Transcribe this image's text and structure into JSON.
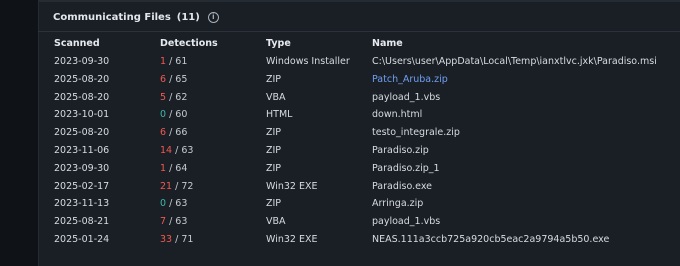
{
  "section": {
    "title": "Communicating Files",
    "count": "(11)",
    "info_icon": "info-icon"
  },
  "columns": {
    "scanned": "Scanned",
    "detections": "Detections",
    "type": "Type",
    "name": "Name"
  },
  "colors": {
    "detection_positive": "#f0584f",
    "detection_zero": "#3fb7a8",
    "link": "#6f9ff0"
  },
  "rows": [
    {
      "scanned": "2023-09-30",
      "det_hits": "1",
      "det_total": " / 61",
      "type": "Windows Installer",
      "name": "C:\\Users\\user\\AppData\\Local\\Temp\\ianxtlvc.jxk\\Paradiso.msi",
      "link": false
    },
    {
      "scanned": "2025-08-20",
      "det_hits": "6",
      "det_total": " / 65",
      "type": "ZIP",
      "name": "Patch_Aruba.zip",
      "link": true
    },
    {
      "scanned": "2025-08-20",
      "det_hits": "5",
      "det_total": " / 62",
      "type": "VBA",
      "name": "payload_1.vbs",
      "link": false
    },
    {
      "scanned": "2023-10-01",
      "det_hits": "0",
      "det_total": " / 60",
      "type": "HTML",
      "name": "down.html",
      "link": false
    },
    {
      "scanned": "2025-08-20",
      "det_hits": "6",
      "det_total": " / 66",
      "type": "ZIP",
      "name": "testo_integrale.zip",
      "link": false
    },
    {
      "scanned": "2023-11-06",
      "det_hits": "14",
      "det_total": " / 63",
      "type": "ZIP",
      "name": "Paradiso.zip",
      "link": false
    },
    {
      "scanned": "2023-09-30",
      "det_hits": "1",
      "det_total": " / 64",
      "type": "ZIP",
      "name": "Paradiso.zip_1",
      "link": false
    },
    {
      "scanned": "2025-02-17",
      "det_hits": "21",
      "det_total": " / 72",
      "type": "Win32 EXE",
      "name": "Paradiso.exe",
      "link": false
    },
    {
      "scanned": "2023-11-13",
      "det_hits": "0",
      "det_total": " / 63",
      "type": "ZIP",
      "name": "Arringa.zip",
      "link": false
    },
    {
      "scanned": "2025-08-21",
      "det_hits": "7",
      "det_total": " / 63",
      "type": "VBA",
      "name": "payload_1.vbs",
      "link": false
    },
    {
      "scanned": "2025-01-24",
      "det_hits": "33",
      "det_total": " / 71",
      "type": "Win32 EXE",
      "name": "NEAS.111a3ccb725a920cb5eac2a9794a5b50.exe",
      "link": false
    }
  ]
}
